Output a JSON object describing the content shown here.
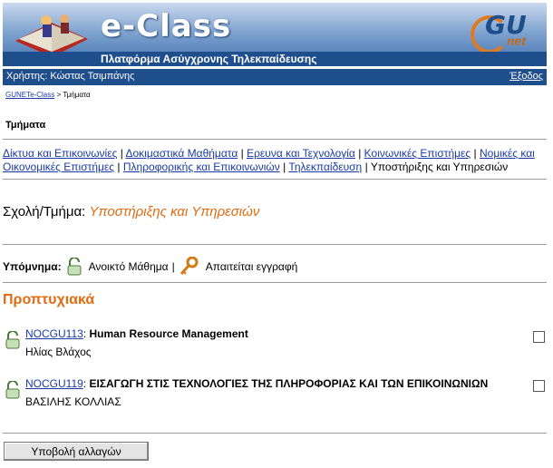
{
  "banner": {
    "title": "e-Class",
    "subtitle": "Πλατφόρμα Ασύγχρονης Τηλεκπαίδευσης",
    "logo_gu": "GU",
    "logo_net": "net"
  },
  "userbar": {
    "user": "Χρήστης: Κώστας Τσιμπάνης",
    "logout": "Έξοδος"
  },
  "breadcrumb": {
    "home": "GUNETe-Class",
    "sep": " > ",
    "current": "Τμήματα"
  },
  "page_title": "Τμήματα",
  "faculties": {
    "items": [
      "Δίκτυα και Επικοινωνίες",
      "Δοκιμαστικά Μαθήματα",
      "Ερευνα και Τεχνολογία",
      "Κοινωνικές Επιστήμες",
      "Νομικές και Οικονομικές Επιστήμες",
      "Πληροφορικής και Επικοινωνιών",
      "Τηλεκπαίδευση"
    ],
    "current": "Υποστήριξης και Υπηρεσιών",
    "sep": " | "
  },
  "school": {
    "label": "Σχολή/Τμήμα:",
    "name": "Υποστήριξης και Υπηρεσιών"
  },
  "legend": {
    "label": "Υπόμνημα:",
    "open": "Ανοικτό Μάθημα",
    "sep": "|",
    "registration": "Απαιτείται εγγραφή"
  },
  "section": "Προπτυχιακά",
  "courses": [
    {
      "code": "NOCGU113",
      "name": "Human Resource Management",
      "professor": "Ηλίας Βλάχος"
    },
    {
      "code": "NOCGU119",
      "name": "ΕΙΣΑΓΩΓΗ ΣΤΙΣ ΤΕΧΝΟΛΟΓΙΕΣ ΤΗΣ ΠΛΗΡΟΦΟΡΙΑΣ ΚΑΙ ΤΩΝ ΕΠΙΚΟΙΝΩΝΙΩΝ",
      "professor": "ΒΑΣΙΛΗΣ ΚΟΛΛΙΑΣ"
    }
  ],
  "submit_label": "Υποβολή αλλαγών"
}
